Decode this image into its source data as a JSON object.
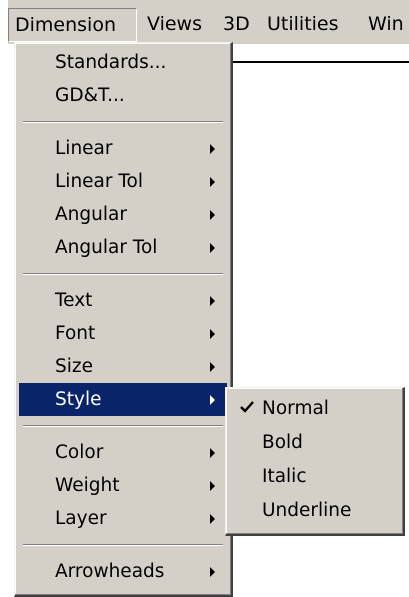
{
  "menubar": {
    "items": [
      "Dimension",
      "Views",
      "3D",
      "Utilities",
      "Win"
    ]
  },
  "dimension_menu": {
    "groups": [
      [
        {
          "label": "Standards...",
          "has_submenu": false
        },
        {
          "label": "GD&T...",
          "has_submenu": false
        }
      ],
      [
        {
          "label": "Linear",
          "has_submenu": true
        },
        {
          "label": "Linear Tol",
          "has_submenu": true
        },
        {
          "label": "Angular",
          "has_submenu": true
        },
        {
          "label": "Angular Tol",
          "has_submenu": true
        }
      ],
      [
        {
          "label": "Text",
          "has_submenu": true
        },
        {
          "label": "Font",
          "has_submenu": true
        },
        {
          "label": "Size",
          "has_submenu": true
        },
        {
          "label": "Style",
          "has_submenu": true,
          "selected": true
        }
      ],
      [
        {
          "label": "Color",
          "has_submenu": true
        },
        {
          "label": "Weight",
          "has_submenu": true
        },
        {
          "label": "Layer",
          "has_submenu": true
        }
      ],
      [
        {
          "label": "Arrowheads",
          "has_submenu": true
        }
      ]
    ]
  },
  "style_submenu": {
    "items": [
      {
        "label": "Normal",
        "checked": true
      },
      {
        "label": "Bold",
        "checked": false
      },
      {
        "label": "Italic",
        "checked": false
      },
      {
        "label": "Underline",
        "checked": false
      }
    ]
  },
  "colors": {
    "menu_bg": "#d4d0c8",
    "selection_bg": "#0a246a",
    "selection_fg": "#ffffff"
  }
}
